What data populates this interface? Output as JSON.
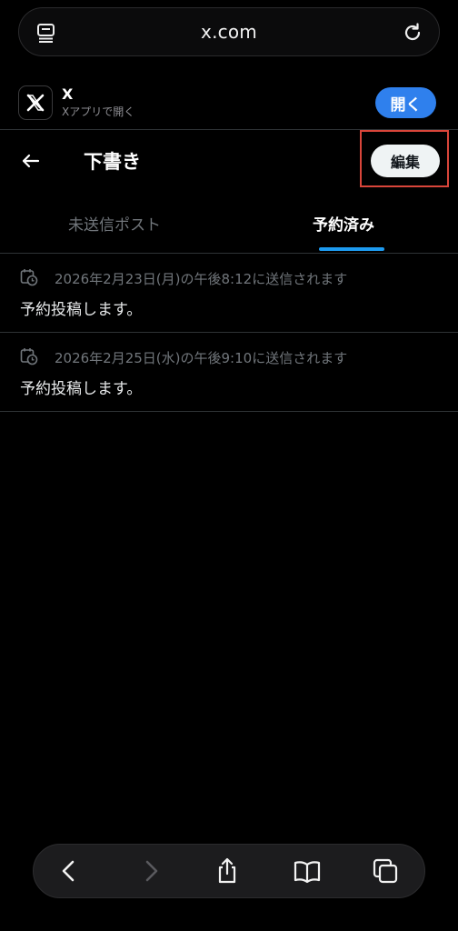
{
  "browser": {
    "url": "x.com",
    "left_icon": "tab-overview-icon",
    "right_icon": "reload-icon"
  },
  "banner": {
    "app_name": "X",
    "app_subtitle": "Xアプリで開く",
    "open_label": "開く",
    "app_icon": "x-logo-icon"
  },
  "header": {
    "title": "下書き",
    "edit_label": "編集"
  },
  "tabs": [
    {
      "label": "未送信ポスト",
      "active": false
    },
    {
      "label": "予約済み",
      "active": true
    }
  ],
  "scheduled": [
    {
      "time": "2026年2月23日(月)の午後8:12に送信されます",
      "text": "予約投稿します。"
    },
    {
      "time": "2026年2月25日(水)の午後9:10に送信されます",
      "text": "予約投稿します。"
    }
  ],
  "colors": {
    "accent": "#1d9bf0",
    "open_button": "#2f80ed",
    "highlight_box": "#d9453a"
  },
  "toolbar_icons": [
    "back-icon",
    "forward-icon",
    "share-icon",
    "bookmarks-icon",
    "tabs-icon"
  ]
}
